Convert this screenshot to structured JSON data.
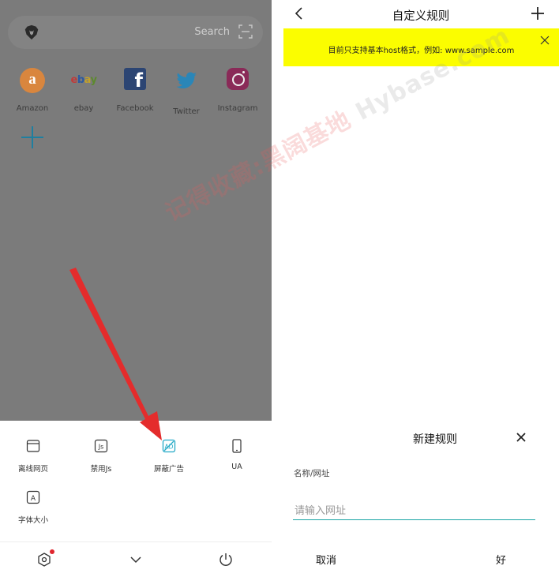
{
  "left": {
    "search_placeholder": "Search",
    "shortcuts": [
      {
        "label": "Amazon",
        "icon": "amazon-icon",
        "color": "#d9863e"
      },
      {
        "label": "ebay",
        "icon": "ebay-icon",
        "color": "#7b7b7b"
      },
      {
        "label": "Facebook",
        "icon": "facebook-icon",
        "color": "#3b5998"
      },
      {
        "label": "Twitter",
        "icon": "twitter-icon",
        "color": "#1da1f2"
      },
      {
        "label": "Instagram",
        "icon": "instagram-icon",
        "color": "#c13584"
      }
    ],
    "tools": [
      {
        "label": "离线网页",
        "icon": "offline-page-icon"
      },
      {
        "label": "禁用Js",
        "icon": "disable-js-icon"
      },
      {
        "label": "屏蔽广告",
        "icon": "block-ads-icon"
      },
      {
        "label": "UA",
        "icon": "phone-icon"
      },
      {
        "label": "字体大小",
        "icon": "font-size-icon"
      }
    ],
    "bottom_icons": [
      "settings-icon",
      "chevron-down-icon",
      "power-icon"
    ],
    "accent": "#23b0c9",
    "notification_color": "#e0252d"
  },
  "right": {
    "title": "自定义规则",
    "banner_text": "目前只支持基本host格式，例如: www.sample.com",
    "banner_color": "#fbfd00",
    "dialog": {
      "title": "新建规则",
      "field_label": "名称/网址",
      "placeholder": "请输入网址",
      "cancel": "取消",
      "ok": "好"
    }
  },
  "watermark": {
    "text1": "记得收藏:黑阔基地",
    "text2": "Hybase.com"
  }
}
